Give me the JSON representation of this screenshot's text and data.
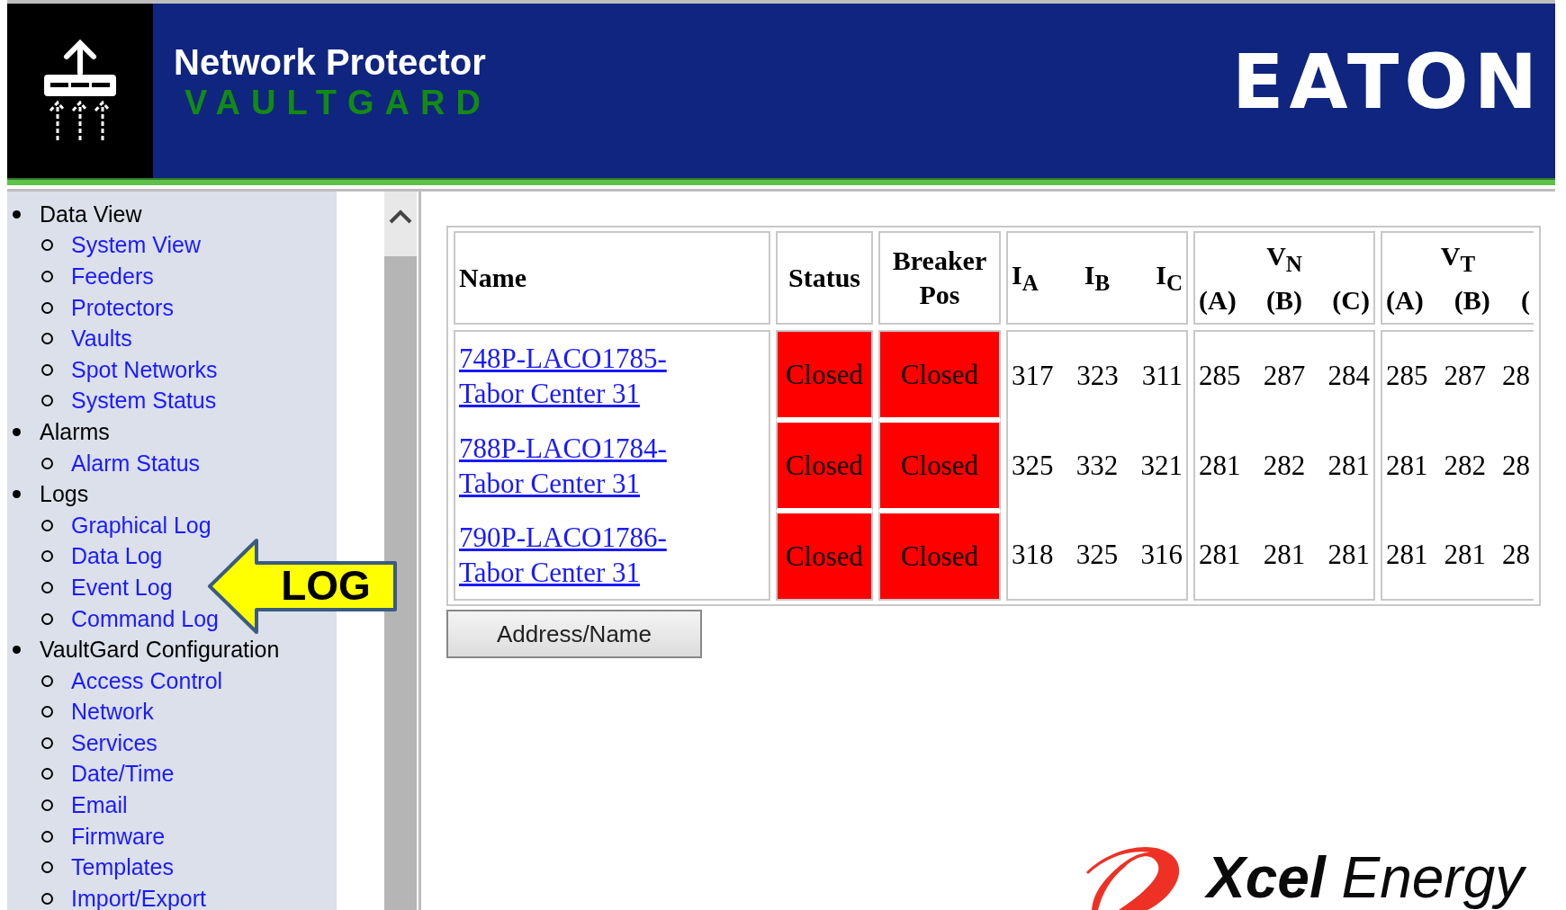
{
  "header": {
    "title": "Network Protector",
    "subtitle": "VAULTGARD",
    "brand": "EATON"
  },
  "nav": [
    {
      "label": "Data View",
      "children": [
        {
          "label": "System View"
        },
        {
          "label": "Feeders"
        },
        {
          "label": "Protectors"
        },
        {
          "label": "Vaults"
        },
        {
          "label": "Spot Networks"
        },
        {
          "label": "System Status"
        }
      ]
    },
    {
      "label": "Alarms",
      "children": [
        {
          "label": "Alarm Status"
        }
      ]
    },
    {
      "label": "Logs",
      "children": [
        {
          "label": "Graphical Log"
        },
        {
          "label": "Data Log"
        },
        {
          "label": "Event Log"
        },
        {
          "label": "Command Log"
        }
      ]
    },
    {
      "label": "VaultGard Configuration",
      "children": [
        {
          "label": "Access Control"
        },
        {
          "label": "Network"
        },
        {
          "label": "Services"
        },
        {
          "label": "Date/Time"
        },
        {
          "label": "Email"
        },
        {
          "label": "Firmware"
        },
        {
          "label": "Templates"
        },
        {
          "label": "Import/Export"
        }
      ]
    }
  ],
  "table": {
    "columns": [
      {
        "kind": "name",
        "label": "Name"
      },
      {
        "kind": "status",
        "label": "Status"
      },
      {
        "kind": "breaker",
        "label": "Breaker Pos"
      },
      {
        "kind": "group",
        "labels": [
          "I$_{A}$",
          "I$_{B}$",
          "I$_{C}$"
        ]
      },
      {
        "kind": "group",
        "label": "V$_{N}$",
        "labels": [
          "(A)",
          "(B)",
          "(C)"
        ]
      },
      {
        "kind": "group",
        "label": "V$_{T}$",
        "labels": [
          "(A)",
          "(B)",
          "("
        ]
      }
    ],
    "rows": [
      {
        "name": "748P-LACO1785-Tabor Center 31",
        "status": {
          "text": "Closed",
          "color": "#ff0000"
        },
        "breaker": {
          "text": "Closed",
          "color": "#ff0000"
        },
        "groups": [
          [
            "317",
            "323",
            "311"
          ],
          [
            "285",
            "287",
            "284"
          ],
          [
            "285",
            "287",
            "28"
          ]
        ]
      },
      {
        "name": "788P-LACO1784-Tabor Center 31",
        "status": {
          "text": "Closed",
          "color": "#ff0000"
        },
        "breaker": {
          "text": "Closed",
          "color": "#ff0000"
        },
        "groups": [
          [
            "325",
            "332",
            "321"
          ],
          [
            "281",
            "282",
            "281"
          ],
          [
            "281",
            "282",
            "28"
          ]
        ]
      },
      {
        "name": "790P-LACO1786-Tabor Center 31",
        "status": {
          "text": "Closed",
          "color": "#ff0000"
        },
        "breaker": {
          "text": "Closed",
          "color": "#ff0000"
        },
        "groups": [
          [
            "318",
            "325",
            "316"
          ],
          [
            "281",
            "281",
            "281"
          ],
          [
            "281",
            "281",
            "28"
          ]
        ]
      }
    ]
  },
  "button": "Address/Name",
  "callout": "LOG",
  "footer_logo": "**Xcel** Energy"
}
